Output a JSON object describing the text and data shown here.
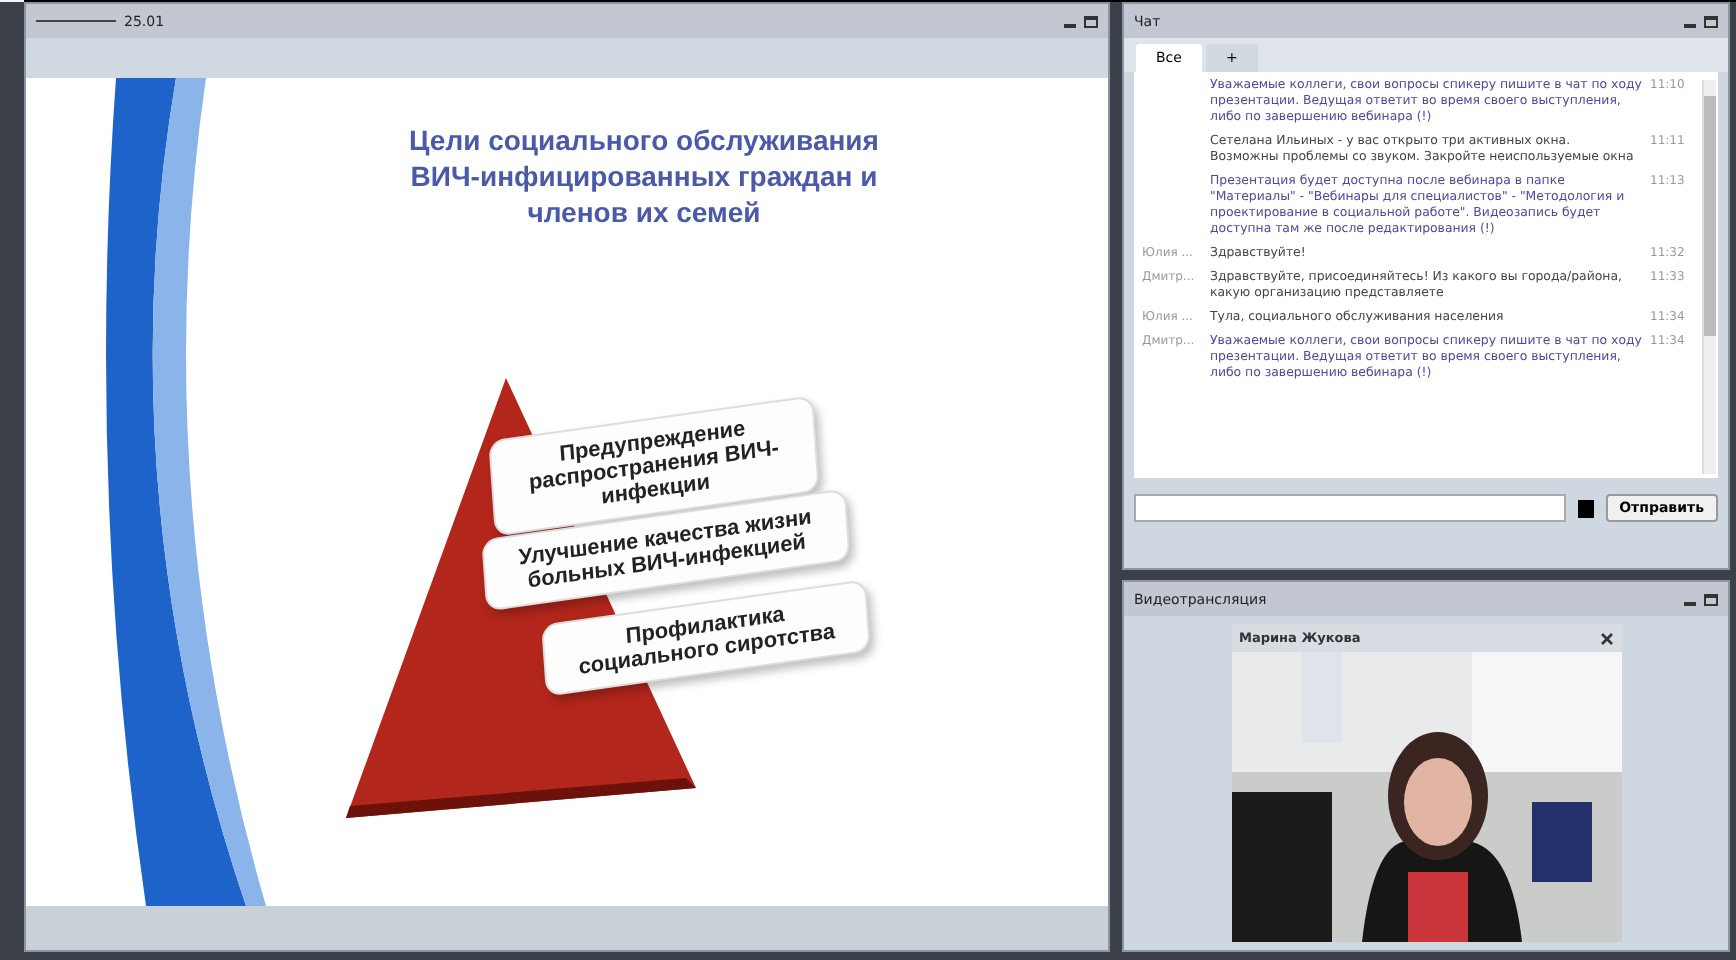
{
  "slide_panel": {
    "title": "25.01",
    "slide": {
      "heading": "Цели социального обслуживания ВИЧ-инфицированных граждан и членов их семей",
      "levels": [
        "Предупреждение распространения ВИЧ-инфекции",
        "Улучшение качества жизни больных ВИЧ-инфекцией",
        "Профилактика социального сиротства"
      ]
    }
  },
  "chat": {
    "title": "Чат",
    "tabs": [
      {
        "label": "Все",
        "selected": true
      },
      {
        "label": "+",
        "selected": false
      }
    ],
    "messages": [
      {
        "text": "Уважаемые коллеги, свои вопросы спикеру пишите в чат по ходу презентации. Ведущая ответит во время своего выступления, либо по завершению вебинара (!)",
        "time": "11:10",
        "kind": "notice"
      },
      {
        "text": "Сетелана Ильиных - у вас открыто три активных окна. Возможны проблемы со звуком. Закройте неиспользуемые окна",
        "time": "11:11",
        "kind": "message"
      },
      {
        "text": "Презентация будет доступна после вебинара в папке \"Материалы\" - \"Вебинары для специалистов\" - \"Методология и проектирование в социальной работе\". Видеозапись будет доступна там же после редактирования (!)",
        "time": "11:13",
        "kind": "notice"
      },
      {
        "sender": "Юлия ...",
        "text": "Здравствуйте!",
        "time": "11:32",
        "kind": "message"
      },
      {
        "sender": "Дмитр...",
        "text": "Здравствуйте, присоединяйтесь! Из какого вы города/района, какую организацию представляете",
        "time": "11:33",
        "kind": "message"
      },
      {
        "sender": "Юлия ...",
        "text": "Тула, социального обслуживания населения",
        "time": "11:34",
        "kind": "message"
      },
      {
        "sender": "Дмитр...",
        "text": "Уважаемые коллеги, свои вопросы спикеру пишите в чат по ходу презентации. Ведущая ответит во время своего выступления, либо по завершению вебинара (!)",
        "time": "11:34",
        "kind": "notice"
      }
    ],
    "send_button": "Отправить"
  },
  "video": {
    "title": "Видеотрансляция",
    "speaker": "Марина Жукова",
    "kind": "picture"
  }
}
